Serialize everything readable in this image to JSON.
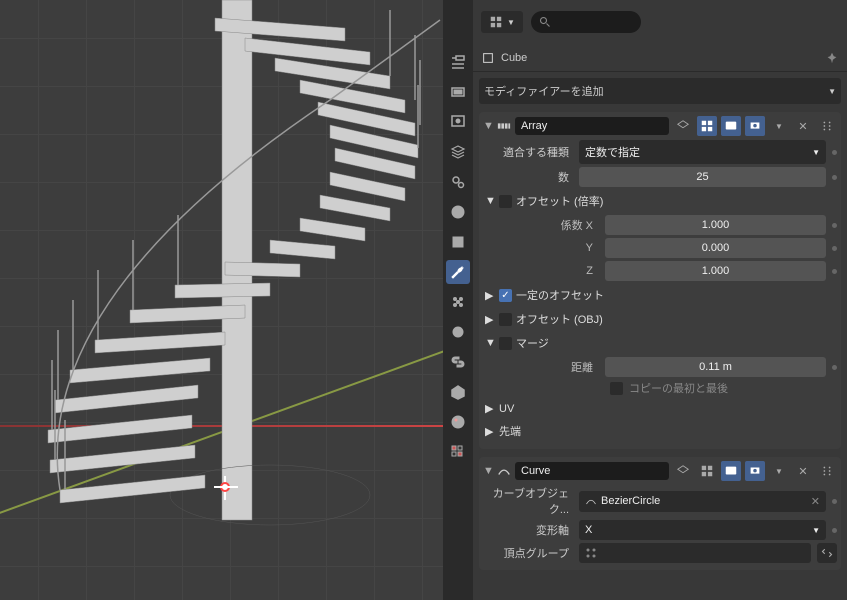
{
  "object_name": "Cube",
  "search_placeholder": "",
  "add_modifier_label": "モディファイアーを追加",
  "modifiers": {
    "array": {
      "name": "Array",
      "fit_type_label": "適合する種類",
      "fit_type_value": "定数で指定",
      "count_label": "数",
      "count_value": "25",
      "relative_offset_label": "オフセット (倍率)",
      "factor_x_label": "係数 X",
      "factor_x": "1.000",
      "factor_y_label": "Y",
      "factor_y": "0.000",
      "factor_z_label": "Z",
      "factor_z": "1.000",
      "constant_offset_label": "一定のオフセット",
      "object_offset_label": "オフセット (OBJ)",
      "merge_label": "マージ",
      "distance_label": "距離",
      "distance_value": "0.11 m",
      "first_last_label": "コピーの最初と最後",
      "uv_label": "UV",
      "cap_label": "先端"
    },
    "curve": {
      "name": "Curve",
      "curve_object_label": "カーブオブジェク...",
      "curve_object_value": "BezierCircle",
      "deform_axis_label": "変形軸",
      "deform_axis_value": "X",
      "vertex_group_label": "頂点グループ"
    }
  }
}
